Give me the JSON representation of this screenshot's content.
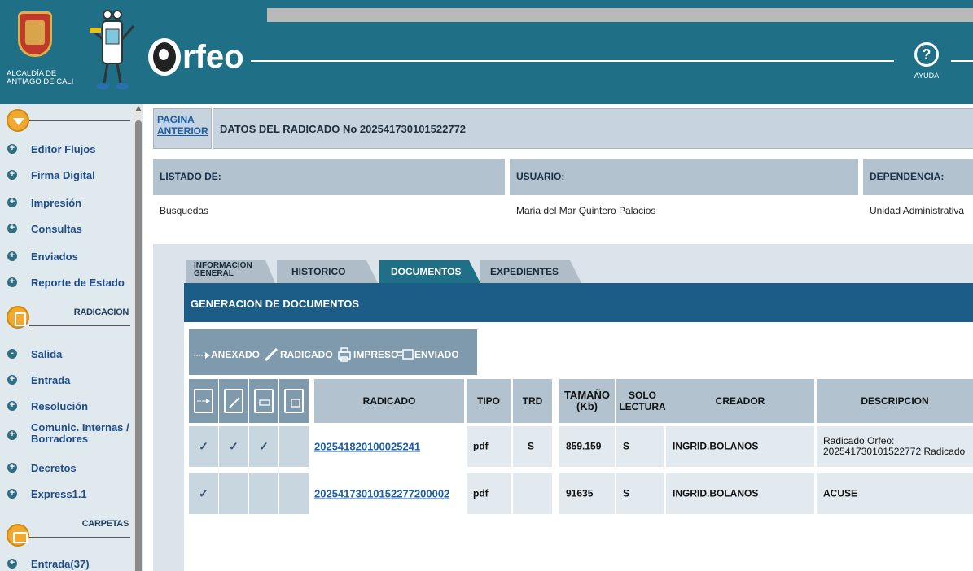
{
  "header": {
    "city_text_line1": "ALCALDÍA DE",
    "city_text_line2": "ANTIAGO DE CALI",
    "app_name": "rfeo",
    "help_label": "AYUDA",
    "help_icon": "?"
  },
  "sidebar": {
    "items_top": [
      {
        "label": "Editor Flujos"
      },
      {
        "label": "Firma Digital"
      },
      {
        "label": "Impresión"
      },
      {
        "label": "Consultas"
      },
      {
        "label": "Enviados"
      },
      {
        "label": "Reporte de Estado"
      }
    ],
    "section_radicacion": "RADICACION",
    "items_radicacion": [
      {
        "label": "Salida",
        "bullet": "-"
      },
      {
        "label": "Entrada",
        "bullet": "+"
      },
      {
        "label": "Resolución",
        "bullet": "+"
      },
      {
        "label": "Comunic. Internas /",
        "label2": "Borradores",
        "bullet": "+"
      },
      {
        "label": "Decretos",
        "bullet": "+"
      },
      {
        "label": "Express1.1",
        "bullet": "+"
      }
    ],
    "section_carpetas": "CARPETAS",
    "items_carpetas": [
      {
        "label": "Entrada(37)",
        "bullet": "+"
      }
    ]
  },
  "top": {
    "page_anterior_line1": "PAGINA",
    "page_anterior_line2": "ANTERIOR",
    "datos_title": "DATOS DEL RADICADO No 202541730101522772"
  },
  "listado": {
    "col1_header": "LISTADO DE:",
    "col2_header": "USUARIO:",
    "col3_header": "DEPENDENCIA:",
    "col1_value": "Busquedas",
    "col2_value": "Maria del Mar Quintero Palacios",
    "col3_value": "Unidad Administrativa"
  },
  "tabs": [
    {
      "label_line1": "INFORMACION",
      "label_line2": "GENERAL",
      "active": false
    },
    {
      "label": "HISTORICO",
      "active": false
    },
    {
      "label": "DOCUMENTOS",
      "active": true
    },
    {
      "label": "EXPEDIENTES",
      "active": false
    }
  ],
  "generacion": {
    "title": "GENERACION DE DOCUMENTOS",
    "legend_anexado": "ANEXADO",
    "legend_radicado": "RADICADO",
    "legend_impreso": "IMPRESO",
    "legend_enviado": "ENVIADO"
  },
  "table": {
    "headers": {
      "radicado": "RADICADO",
      "tipo": "TIPO",
      "trd": "TRD",
      "tamano_line1": "TAMAÑO",
      "tamano_line2": "(Kb)",
      "solo_line1": "SOLO",
      "solo_line2": "LECTURA",
      "creador": "CREADOR",
      "descripcion": "DESCRIPCION"
    },
    "rows": [
      {
        "checks": [
          "✓",
          "✓",
          "✓",
          ""
        ],
        "radicado": "202541820100025241",
        "tipo": "pdf",
        "trd": "S",
        "tamano": "859.159",
        "solo": "S",
        "creador": "INGRID.BOLANOS",
        "descripcion_line1": "Radicado Orfeo:",
        "descripcion_line2": "202541730101522772 Radicado"
      },
      {
        "checks": [
          "✓",
          "",
          "",
          ""
        ],
        "radicado": "20254173010152277200002",
        "tipo": "pdf",
        "trd": "",
        "tamano": "91635",
        "solo": "S",
        "creador": "INGRID.BOLANOS",
        "descripcion_line1": "ACUSE",
        "descripcion_line2": ""
      }
    ]
  },
  "colors": {
    "header_bg": "#1f6f86",
    "sidebar_bg": "#dfe9ee",
    "accent_orange": "#f0a830",
    "gen_bar": "#1b5d87",
    "link": "#1a5ea8"
  }
}
